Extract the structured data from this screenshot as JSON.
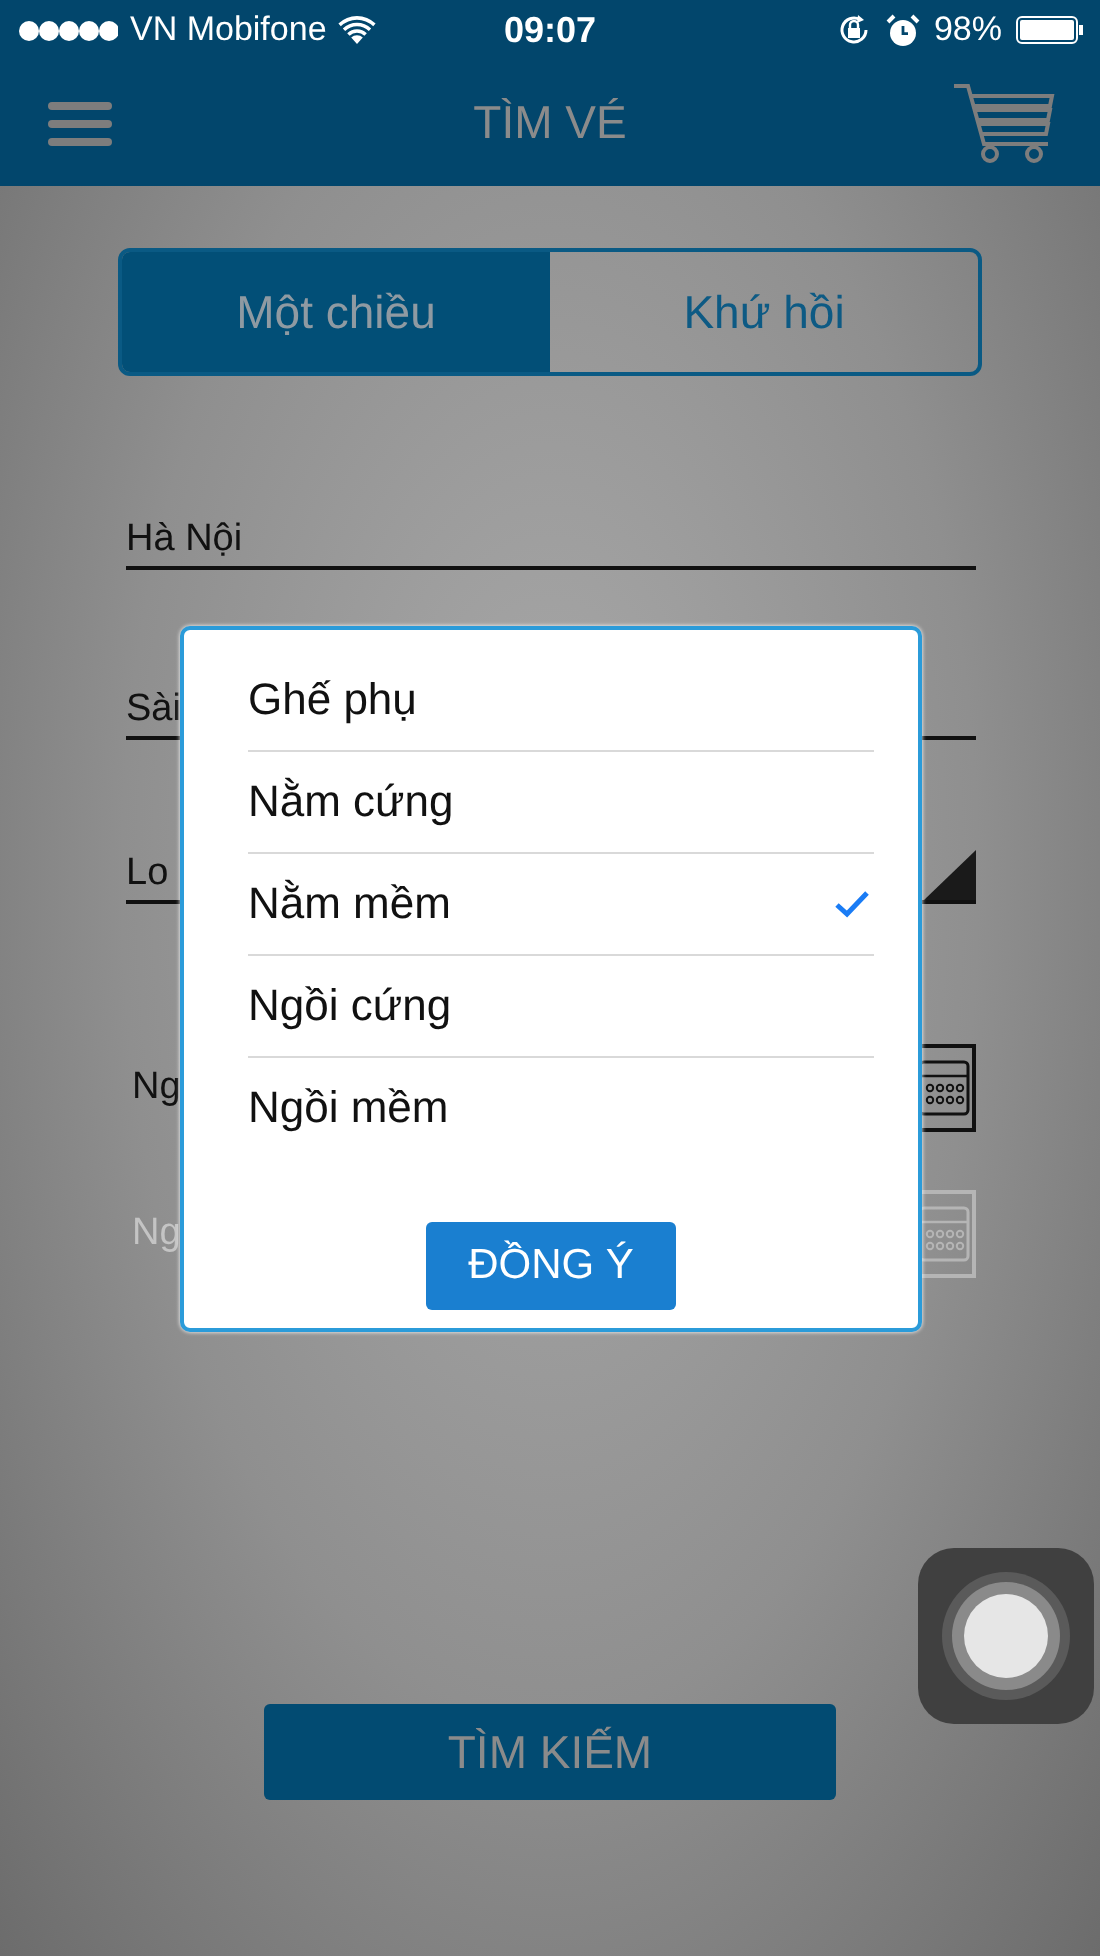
{
  "status_bar": {
    "carrier": "VN Mobifone",
    "time": "09:07",
    "battery": "98%"
  },
  "header": {
    "title": "TÌM VÉ"
  },
  "trip_tabs": [
    {
      "label": "Một chiều",
      "selected": true
    },
    {
      "label": "Khứ hồi",
      "selected": false
    }
  ],
  "fields": [
    {
      "kind": "text",
      "value": "Hà Nội"
    },
    {
      "kind": "text",
      "value": "Sài"
    },
    {
      "kind": "select",
      "value": "Lo"
    },
    {
      "kind": "date",
      "label": "Ng",
      "disabled": false
    },
    {
      "kind": "date",
      "label": "Ng",
      "disabled": true
    }
  ],
  "seat_dialog": {
    "options": [
      {
        "label": "Ghế phụ",
        "selected": false
      },
      {
        "label": "Nằm cứng",
        "selected": false
      },
      {
        "label": "Nằm mềm",
        "selected": true
      },
      {
        "label": "Ngồi cứng",
        "selected": false
      },
      {
        "label": "Ngồi mềm",
        "selected": false
      }
    ],
    "confirm": "ĐỒNG Ý"
  },
  "search_button": "TÌM KIẾM"
}
